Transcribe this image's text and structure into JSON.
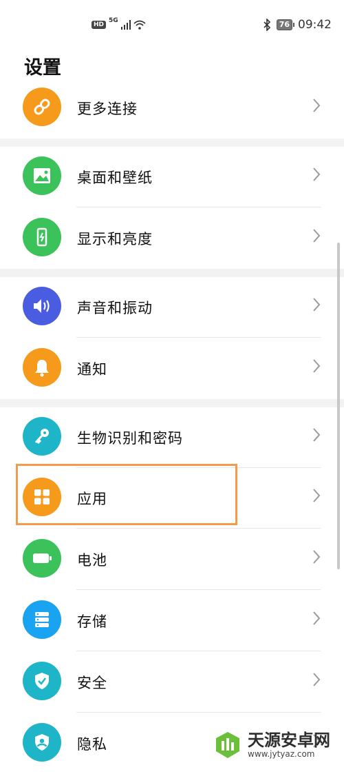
{
  "status_bar": {
    "hd_label": "HD",
    "network_label": "5G",
    "battery_level": "76",
    "time": "09:42"
  },
  "header": {
    "title": "设置"
  },
  "settings_items": [
    {
      "label": "更多连接",
      "icon": "link-icon",
      "color": "#f59a1b"
    },
    {
      "label": "桌面和壁纸",
      "icon": "image-icon",
      "color": "#3cc25a"
    },
    {
      "label": "显示和亮度",
      "icon": "phone-brightness-icon",
      "color": "#3cc25a"
    },
    {
      "label": "声音和振动",
      "icon": "speaker-icon",
      "color": "#4a5de0"
    },
    {
      "label": "通知",
      "icon": "bell-icon",
      "color": "#f59a1b"
    },
    {
      "label": "生物识别和密码",
      "icon": "key-icon",
      "color": "#1fb5c9"
    },
    {
      "label": "应用",
      "icon": "apps-grid-icon",
      "color": "#f59a1b"
    },
    {
      "label": "电池",
      "icon": "battery-icon",
      "color": "#3cc25a"
    },
    {
      "label": "存储",
      "icon": "storage-icon",
      "color": "#1aa3f0"
    },
    {
      "label": "安全",
      "icon": "shield-check-icon",
      "color": "#1fb5c9"
    },
    {
      "label": "隐私",
      "icon": "privacy-icon",
      "color": "#1fb5c9"
    }
  ],
  "highlight_color": "#f39a4b",
  "watermark": {
    "title": "天源安卓网",
    "url": "www.jytyaz.com"
  }
}
